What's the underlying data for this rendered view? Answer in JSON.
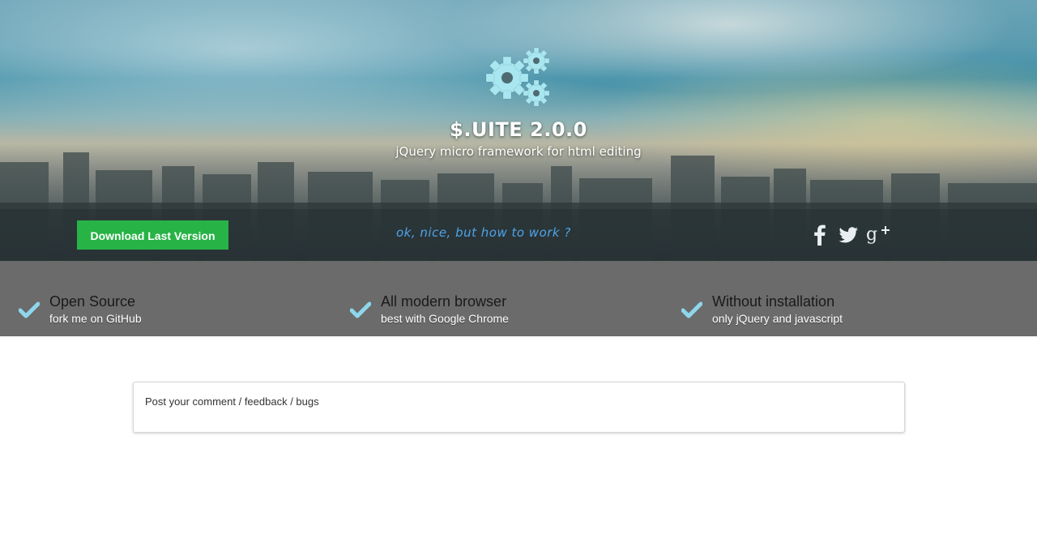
{
  "hero": {
    "title": "$.UITE 2.0.0",
    "subtitle": "jQuery micro framework for html editing",
    "logo_icon": "gears-icon",
    "accent_color": "#a8e6f0"
  },
  "action_bar": {
    "download_label": "Download Last Version",
    "download_color": "#27b346",
    "how_link_label": "ok, nice, but how to work ?",
    "social": [
      {
        "name": "facebook-icon"
      },
      {
        "name": "twitter-icon"
      },
      {
        "name": "google-plus-icon"
      }
    ]
  },
  "features": [
    {
      "title": "Open Source",
      "subtitle": "fork me on GitHub",
      "icon": "check-icon"
    },
    {
      "title": "All modern browser",
      "subtitle": "best with Google Chrome",
      "icon": "check-icon"
    },
    {
      "title": "Without installation",
      "subtitle": "only jQuery and javascript",
      "icon": "check-icon"
    }
  ],
  "comments": {
    "placeholder": "Post your comment / feedback / bugs"
  }
}
